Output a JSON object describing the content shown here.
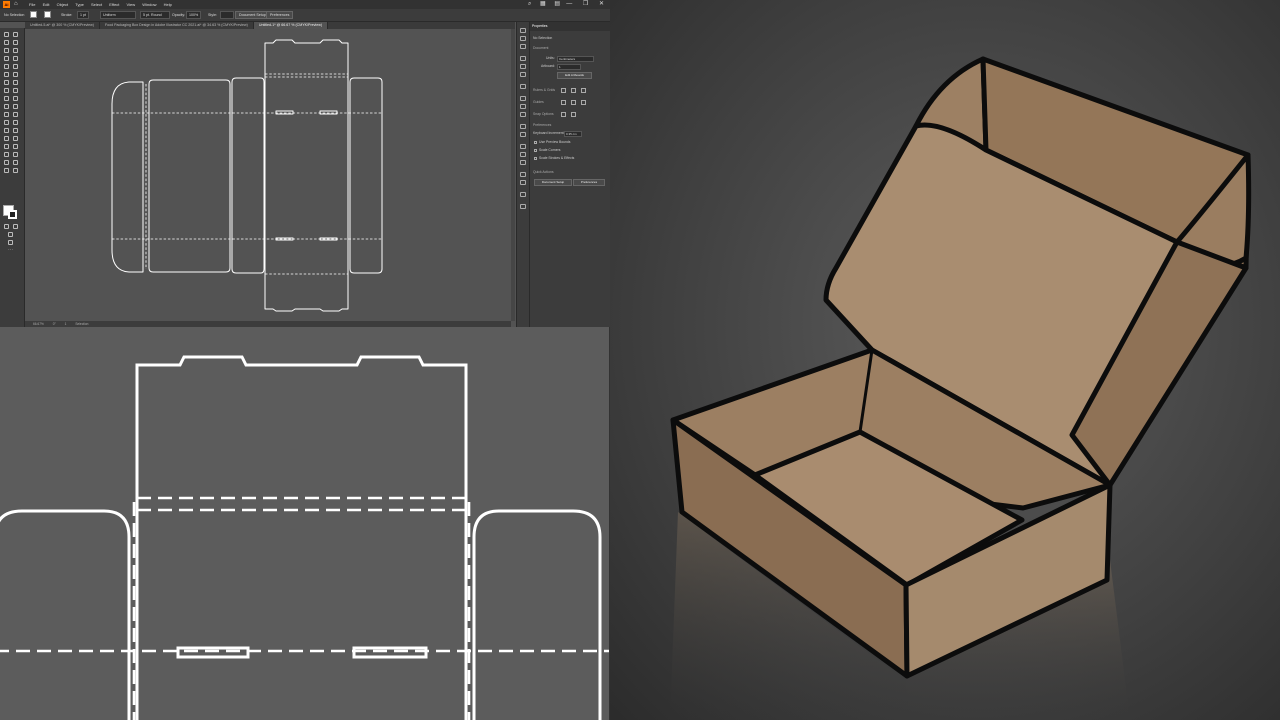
{
  "app": {
    "logo": "Ai",
    "home": "⌂",
    "menus": [
      "File",
      "Edit",
      "Object",
      "Type",
      "Select",
      "Effect",
      "View",
      "Window",
      "Help"
    ],
    "right_icons": [
      "search-icon",
      "grid-icon",
      "arrange-icon"
    ],
    "window_controls": [
      "—",
      "❐",
      "✕"
    ]
  },
  "control_bar": {
    "selection": "No Selection",
    "stroke_label": "Stroke:",
    "stroke_value": "1 pt",
    "stroke_style": "Uniform",
    "brush": "5 pt. Round",
    "opacity_label": "Opacity:",
    "opacity_value": "100%",
    "style_label": "Style:",
    "document_setup": "Document Setup",
    "preferences": "Preferences"
  },
  "tabs": [
    {
      "label": "Untitled-5.ai* @ 300 % (CMYK/Preview)",
      "active": false
    },
    {
      "label": "Food Packaging Box Design in Adobe Illustrator CC 2021.ai* @ 34.63 % (CMYK/Preview)",
      "active": false
    },
    {
      "label": "Untitled-1* @ 66.67 % (CMYK/Preview)",
      "active": true
    }
  ],
  "status_bar": {
    "zoom": "66.67%",
    "rotation": "0°",
    "artboard": "1",
    "tool": "Selection"
  },
  "properties": {
    "tab": "Properties",
    "selection": "No Selection",
    "document_heading": "Document",
    "units_label": "Units:",
    "units_value": "Centimeters",
    "artboard_label": "Artboard:",
    "artboard_value": "1",
    "edit_artboards": "Edit Artboards",
    "rulers_grids": "Rulers & Grids",
    "guides": "Guides",
    "snap_options": "Snap Options",
    "preferences_heading": "Preferences",
    "keyboard_increment_label": "Keyboard Increment:",
    "keyboard_increment_value": "0.35 cm",
    "use_preview_bounds": "Use Preview Bounds",
    "scale_corners": "Scale Corners",
    "scale_strokes": "Scale Strokes & Effects",
    "quick_actions": "Quick Actions",
    "document_setup_btn": "Document Setup",
    "preferences_btn": "Preferences"
  },
  "colors": {
    "app_bg": "#535353",
    "panel": "#3c3c3c",
    "dieline": "#ffffff",
    "box_kraft": "#a58a6d",
    "accent": "#ff7c00"
  }
}
